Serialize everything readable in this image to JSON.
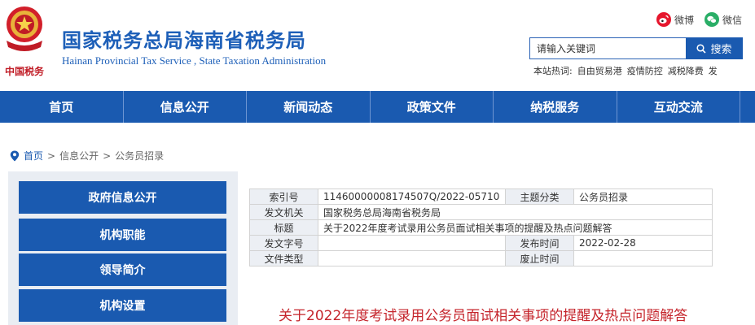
{
  "header": {
    "site_title": "国家税务总局海南省税务局",
    "site_subtitle": "Hainan Provincial Tax Service , State Taxation Administration",
    "emblem_text": "中国税务",
    "social": {
      "weibo": "微博",
      "weixin": "微信"
    },
    "search": {
      "placeholder": "请输入关键词",
      "button": "搜索"
    },
    "hotwords": {
      "label": "本站热词:",
      "items": [
        "自由贸易港",
        "疫情防控",
        "减税降费",
        "发"
      ]
    }
  },
  "nav": {
    "items": [
      "首页",
      "信息公开",
      "新闻动态",
      "政策文件",
      "纳税服务",
      "互动交流"
    ]
  },
  "breadcrumb": {
    "items": [
      "首页",
      "信息公开",
      "公务员招录"
    ],
    "separator": ">"
  },
  "sidebar": {
    "items": [
      "政府信息公开",
      "机构职能",
      "领导简介",
      "机构设置"
    ]
  },
  "info": {
    "index_label": "索引号",
    "index_value": "11460000008174507Q/2022-05710",
    "topic_label": "主题分类",
    "topic_value": "公务员招录",
    "issuer_label": "发文机关",
    "issuer_value": "国家税务总局海南省税务局",
    "title_label": "标题",
    "title_value": "关于2022年度考试录用公务员面试相关事项的提醒及热点问题解答",
    "docno_label": "发文字号",
    "docno_value": "",
    "date_label": "发布时间",
    "date_value": "2022-02-28",
    "type_label": "文件类型",
    "type_value": "",
    "abolish_label": "废止时间",
    "abolish_value": ""
  },
  "article": {
    "title": "关于2022年度考试录用公务员面试相关事项的提醒及热点问题解答"
  },
  "colors": {
    "brand_blue": "#1a5ab0",
    "title_red": "#c5242b",
    "panel_grey": "#e9edf3"
  }
}
